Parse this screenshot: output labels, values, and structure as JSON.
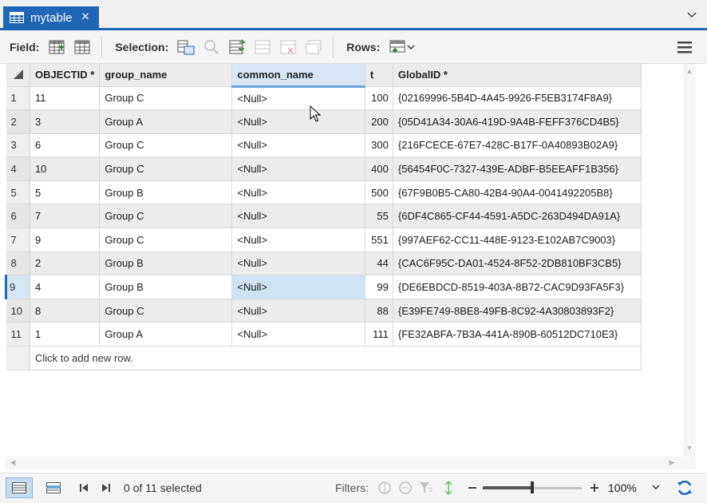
{
  "tab": {
    "title": "mytable",
    "close": "✕"
  },
  "toolbar": {
    "field_label": "Field:",
    "selection_label": "Selection:",
    "rows_label": "Rows:"
  },
  "columns": [
    "OBJECTID *",
    "group_name",
    "common_name",
    "t",
    "GlobalID *"
  ],
  "rows": [
    {
      "n": "1",
      "objectid": "11",
      "group": "Group C",
      "common": "<Null>",
      "t": "100",
      "gid": "{02169996-5B4D-4A45-9926-F5EB3174F8A9}"
    },
    {
      "n": "2",
      "objectid": "3",
      "group": "Group A",
      "common": "<Null>",
      "t": "200",
      "gid": "{05D41A34-30A6-419D-9A4B-FEFF376CD4B5}"
    },
    {
      "n": "3",
      "objectid": "6",
      "group": "Group C",
      "common": "<Null>",
      "t": "300",
      "gid": "{216FCECE-67E7-428C-B17F-0A40893B02A9}"
    },
    {
      "n": "4",
      "objectid": "10",
      "group": "Group C",
      "common": "<Null>",
      "t": "400",
      "gid": "{56454F0C-7327-439E-ADBF-B5EEAFF1B356}"
    },
    {
      "n": "5",
      "objectid": "5",
      "group": "Group B",
      "common": "<Null>",
      "t": "500",
      "gid": "{67F9B0B5-CA80-42B4-90A4-0041492205B8}"
    },
    {
      "n": "6",
      "objectid": "7",
      "group": "Group C",
      "common": "<Null>",
      "t": "55",
      "gid": "{6DF4C865-CF44-4591-A5DC-263D494DA91A}"
    },
    {
      "n": "7",
      "objectid": "9",
      "group": "Group C",
      "common": "<Null>",
      "t": "551",
      "gid": "{997AEF62-CC11-448E-9123-E102AB7C9003}"
    },
    {
      "n": "8",
      "objectid": "2",
      "group": "Group B",
      "common": "<Null>",
      "t": "44",
      "gid": "{CAC6F95C-DA01-4524-8F52-2DB810BF3CB5}"
    },
    {
      "n": "9",
      "objectid": "4",
      "group": "Group B",
      "common": "<Null>",
      "t": "99",
      "gid": "{DE6EBDCD-8519-403A-8B72-CAC9D93FA5F3}"
    },
    {
      "n": "10",
      "objectid": "8",
      "group": "Group C",
      "common": "<Null>",
      "t": "88",
      "gid": "{E39FE749-8BE8-49FB-8C92-4A30803893F2}"
    },
    {
      "n": "11",
      "objectid": "1",
      "group": "Group A",
      "common": "<Null>",
      "t": "111",
      "gid": "{FE32ABFA-7B3A-441A-890B-60512DC710E3}"
    }
  ],
  "add_row_text": "Click to add new row.",
  "status": {
    "selected_text": "0 of 11 selected",
    "filters_label": "Filters:",
    "zoom_value": "100%",
    "zoom_fraction": 0.5
  },
  "colors": {
    "accent": "#1f67b4",
    "selection": "#cfe3f5"
  }
}
